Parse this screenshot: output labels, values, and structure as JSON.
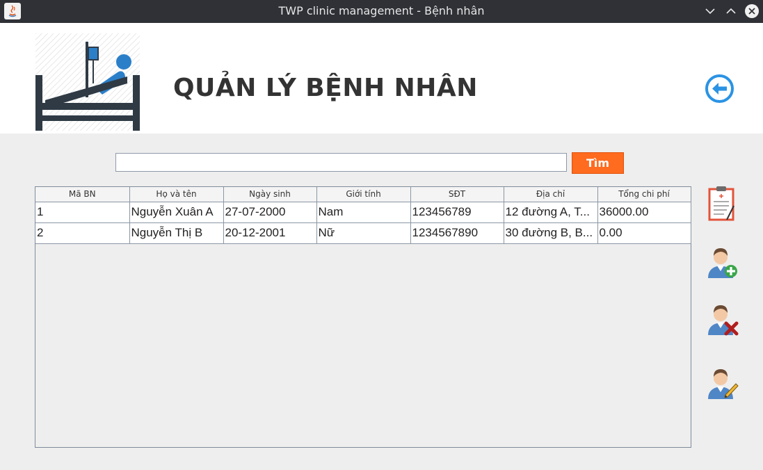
{
  "window": {
    "title": "TWP clinic management - Bệnh nhân"
  },
  "header": {
    "title": "QUẢN LÝ BỆNH NHÂN",
    "logo_icon": "patient-bed-icon",
    "back_icon": "back-arrow-icon"
  },
  "search": {
    "value": "",
    "placeholder": "",
    "button_label": "Tìm",
    "button_color": "#ff6b1f"
  },
  "table": {
    "columns": [
      "Mã BN",
      "Họ và tên",
      "Ngày sinh",
      "Giới tính",
      "SĐT",
      "Địa chỉ",
      "Tổng chi phí"
    ],
    "rows": [
      [
        "1",
        "Nguyễn Xuân A",
        "27-07-2000",
        "Nam",
        "123456789",
        "12 đường A, T...",
        "36000.00"
      ],
      [
        "2",
        "Nguyễn Thị B",
        "20-12-2001",
        "Nữ",
        "1234567890",
        "30 đường B, B...",
        "0.00"
      ]
    ]
  },
  "tools": [
    {
      "icon": "medical-record-icon"
    },
    {
      "icon": "add-patient-icon"
    },
    {
      "icon": "delete-patient-icon"
    },
    {
      "icon": "edit-patient-icon"
    }
  ]
}
